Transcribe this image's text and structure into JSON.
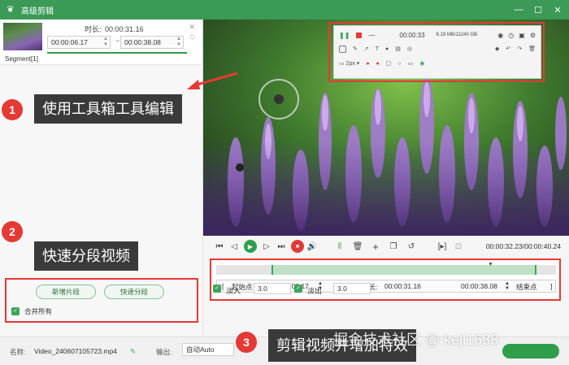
{
  "window": {
    "title": "高级剪辑",
    "minimize": "—",
    "maximize": "☐",
    "close": "✕"
  },
  "segment": {
    "duration_label": "时长:",
    "duration_value": "00:00:31.16",
    "start": "00:00:06.17",
    "end": "00:00:38.08",
    "name": "Segment[1]"
  },
  "left_actions": {
    "new_segment": "新增片段",
    "quick_split": "快速分段",
    "merge_all": "合并所有"
  },
  "toolbox": {
    "time": "00:00:33",
    "size": "6.19 MB/11240 GB"
  },
  "annotations": {
    "one": "1",
    "one_text": "使用工具箱工具编辑",
    "two": "2",
    "two_text": "快速分段视频",
    "three": "3",
    "three_text": "剪辑视频并增加特效"
  },
  "player": {
    "time_readout": "00:00:32.23/00:00:40.24"
  },
  "timeline": {
    "start_label": "起始点",
    "start_value": "00:00:06.17",
    "duration_label": "时长:",
    "duration_value": "00:00:31.16",
    "end_value": "00:00:38.08",
    "end_label": "结束点",
    "fade_in_label": "淡入",
    "fade_in_value": "3.0",
    "fade_out_label": "淡出",
    "fade_out_value": "3.0"
  },
  "bottom": {
    "name_label": "名称:",
    "file_name": "Video_240607105723.mp4",
    "output_label": "输出:",
    "output_value": "自动Auto"
  },
  "watermark": "掘金技术社区 @ keji1688",
  "colors": {
    "brand": "#3b9a56",
    "annotation_red": "#e53935",
    "callout_bg": "#3a3a3a"
  }
}
